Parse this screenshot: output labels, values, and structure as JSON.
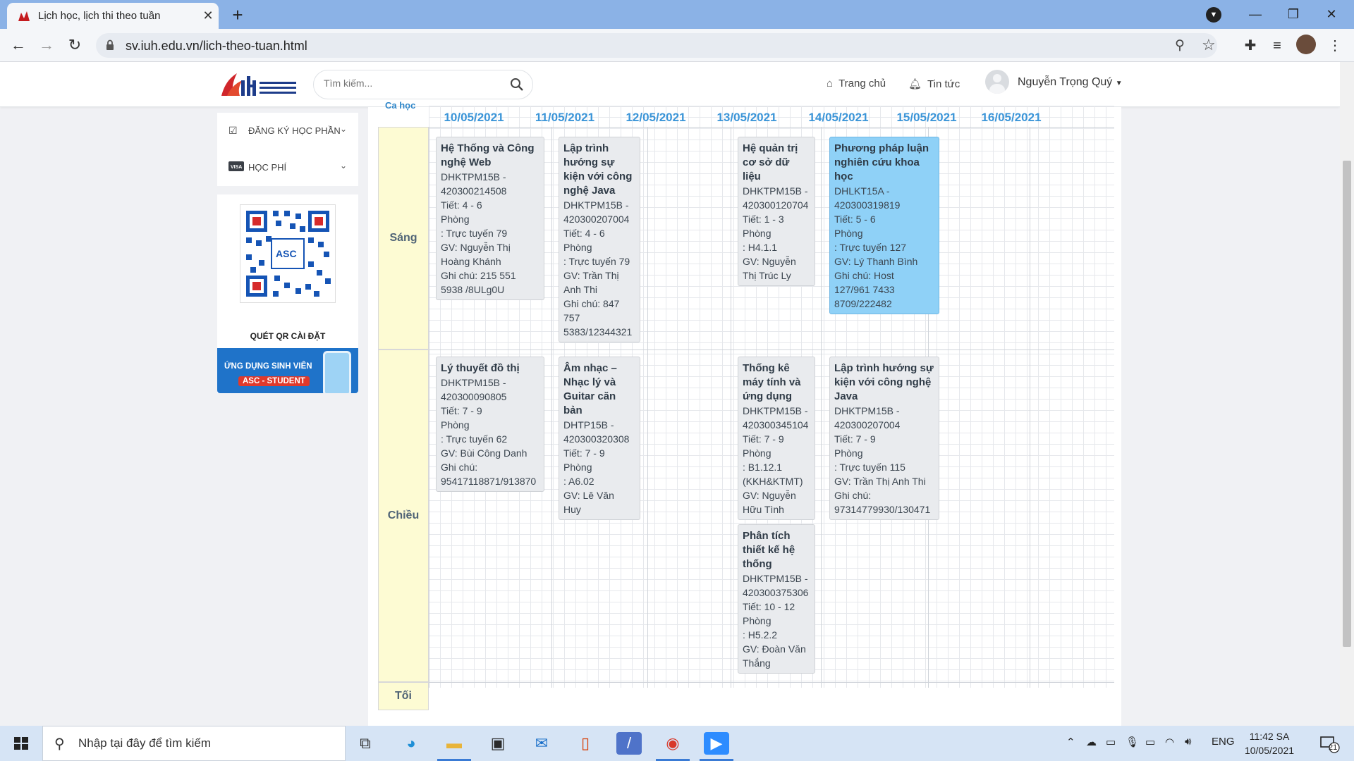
{
  "browser": {
    "tab_title": "Lịch học, lịch thi theo tuần",
    "tab_close": "✕",
    "new_tab": "+",
    "url": "sv.iuh.edu.vn/lich-theo-tuan.html"
  },
  "site": {
    "search_placeholder": "Tìm kiếm...",
    "nav": {
      "home": "Trang chủ",
      "news": "Tin tức"
    },
    "user_name": "Nguyễn Trọng Quý"
  },
  "sidebar": {
    "items": [
      {
        "label": "ĐĂNG KÝ HỌC PHẦN",
        "icon": "checkbox-icon"
      },
      {
        "label": "HỌC PHÍ",
        "icon": "visa-card-icon"
      }
    ],
    "qr_label": "QUÉT QR CÀI ĐẶT",
    "app_banner_line1": "ỨNG DỤNG SINH VIÊN",
    "app_banner_line2": "ASC - STUDENT"
  },
  "schedule": {
    "caption": "Ca học",
    "days": [
      "10/05/2021",
      "11/05/2021",
      "12/05/2021",
      "13/05/2021",
      "14/05/2021",
      "15/05/2021",
      "16/05/2021"
    ],
    "shifts": [
      "Sáng",
      "Chiều",
      "Tối"
    ],
    "classes": {
      "sang_d1": {
        "title": "Hệ Thống và Công nghệ Web",
        "lines": [
          "DHKTPM15B -",
          "420300214508",
          "Tiết: 4 - 6",
          "Phòng",
          ": Trực tuyến 79",
          "GV: Nguyễn Thị",
          "Hoàng Khánh",
          "Ghi chú: 215 551",
          "5938 /8ULg0U"
        ]
      },
      "sang_d2": {
        "title": "Lập trình hướng sự kiện với công nghệ Java",
        "lines": [
          "DHKTPM15B -",
          "420300207004",
          "Tiết: 4 - 6",
          "Phòng",
          ": Trực tuyến 79",
          "GV: Trần Thị",
          "Anh Thi",
          "Ghi chú: 847",
          "757",
          "5383/12344321"
        ]
      },
      "sang_d4": {
        "title": "Hệ quản trị cơ sở dữ liệu",
        "lines": [
          "DHKTPM15B -",
          "420300120704",
          "Tiết: 1 - 3",
          "Phòng",
          ": H4.1.1",
          "GV: Nguyễn",
          "Thị Trúc Ly"
        ]
      },
      "sang_d5": {
        "title": "Phương pháp luận nghiên cứu khoa học",
        "lines": [
          "DHLKT15A -",
          "420300319819",
          "Tiết: 5 - 6",
          "Phòng",
          ": Trực tuyến 127",
          "GV: Lý Thanh Bình",
          "Ghi chú: Host",
          "127/961 7433",
          "8709/222482"
        ]
      },
      "chieu_d1": {
        "title": "Lý thuyết đồ thị",
        "lines": [
          "DHKTPM15B -",
          "420300090805",
          "Tiết: 7 - 9",
          "Phòng",
          ": Trực tuyến 62",
          "GV: Bùi Công Danh",
          "Ghi chú:",
          "95417118871/913870"
        ]
      },
      "chieu_d2": {
        "title": "Âm nhạc – Nhạc lý và Guitar căn bản",
        "lines": [
          "DHTP15B -",
          "420300320308",
          "Tiết: 7 - 9",
          "Phòng",
          ": A6.02",
          "GV: Lê Văn",
          "Huy"
        ]
      },
      "chieu_d4a": {
        "title": "Thống kê máy tính và ứng dụng",
        "lines": [
          "DHKTPM15B -",
          "420300345104",
          "Tiết: 7 - 9",
          "Phòng",
          ": B1.12.1",
          "(KKH&KTMT)",
          "GV: Nguyễn",
          "Hữu Tình"
        ]
      },
      "chieu_d4b": {
        "title": "Phân tích thiết kế hệ thống",
        "lines": [
          "DHKTPM15B -",
          "420300375306",
          "Tiết: 10 - 12",
          "Phòng",
          ": H5.2.2",
          "GV: Đoàn Văn",
          "Thắng"
        ]
      },
      "chieu_d5": {
        "title": "Lập trình hướng sự kiện với công nghệ Java",
        "lines": [
          "DHKTPM15B -",
          "420300207004",
          "Tiết: 7 - 9",
          "Phòng",
          ": Trực tuyến 115",
          "GV: Trần Thị Anh Thi",
          "Ghi chú:",
          "97314779930/130471"
        ]
      }
    }
  },
  "taskbar": {
    "search_text": "Nhập tại đây để tìm kiếm",
    "lang": "ENG",
    "time": "11:42 SA",
    "date": "10/05/2021",
    "notification_count": "21"
  },
  "colors": {
    "browser_frame": "#8bb2e6",
    "day_header": "#3b95d8",
    "shift_cell": "#fdfbd3",
    "highlight_card": "#8fd1f7",
    "taskbar": "#d6e4f5"
  }
}
